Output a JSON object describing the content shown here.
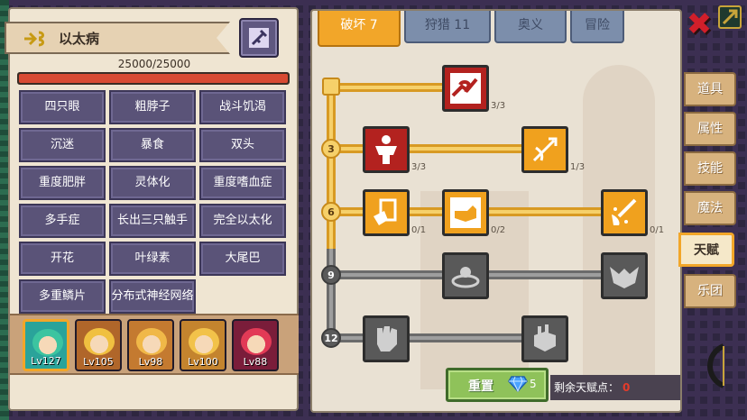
{
  "character": {
    "name": "以太病",
    "hp_text": "25000/25000",
    "hp_fraction": 1.0
  },
  "traits": [
    "四只眼",
    "粗脖子",
    "战斗饥渴",
    "沉迷",
    "暴食",
    "双头",
    "重度肥胖",
    "灵体化",
    "重度嗜血症",
    "多手症",
    "长出三只触手",
    "完全以太化",
    "开花",
    "叶绿素",
    "大尾巴",
    "多重鳞片",
    "分布式神经网络"
  ],
  "party": [
    {
      "level": "Lv127",
      "color": "#2aa39a",
      "hair": "#3cc4a0",
      "selected": true
    },
    {
      "level": "Lv105",
      "color": "#b0662a",
      "hair": "#f0c040",
      "selected": false
    },
    {
      "level": "Lv98",
      "color": "#c47a30",
      "hair": "#f0b848",
      "selected": false
    },
    {
      "level": "Lv100",
      "color": "#c4842e",
      "hair": "#f2c24a",
      "selected": false
    },
    {
      "level": "Lv88",
      "color": "#7a1d3a",
      "hair": "#e23a56",
      "selected": false
    }
  ],
  "talent_tabs": [
    {
      "label": "破坏 7",
      "active": true
    },
    {
      "label": "狩猎 11",
      "active": false
    },
    {
      "label": "奥义",
      "active": false
    },
    {
      "label": "冒险",
      "active": false
    }
  ],
  "tree": {
    "levels": [
      "3",
      "6",
      "9",
      "12"
    ],
    "nodes": [
      {
        "name": "arm-wrestle-node",
        "icon": "arm-wrestle-icon",
        "style": "red",
        "count": "3/3"
      },
      {
        "name": "muscle-body-node",
        "icon": "muscle-body-icon",
        "style": "red",
        "count": "3/3"
      },
      {
        "name": "arrow-hit-node",
        "icon": "arrow-hit-icon",
        "style": "orange",
        "count": "1/3"
      },
      {
        "name": "card-hand-node",
        "icon": "card-hand-icon",
        "style": "orange",
        "count": "0/1"
      },
      {
        "name": "punch-node",
        "icon": "punch-icon",
        "style": "orange",
        "count": "0/2"
      },
      {
        "name": "slash-node",
        "icon": "slash-icon",
        "style": "orange",
        "count": "0/1"
      },
      {
        "name": "impact-node",
        "icon": "impact-icon",
        "style": "grey",
        "count": ""
      },
      {
        "name": "demon-node",
        "icon": "demon-icon",
        "style": "grey",
        "count": ""
      },
      {
        "name": "fist-node",
        "icon": "fist-icon",
        "style": "grey",
        "count": ""
      },
      {
        "name": "grip-node",
        "icon": "grip-icon",
        "style": "grey",
        "count": ""
      }
    ]
  },
  "reset": {
    "label": "重置",
    "cost": "5"
  },
  "points": {
    "label": "剩余天赋点：",
    "value": "0"
  },
  "side_tabs": [
    "道具",
    "属性",
    "技能",
    "魔法",
    "天赋",
    "乐团"
  ],
  "active_side_tab": "天赋"
}
